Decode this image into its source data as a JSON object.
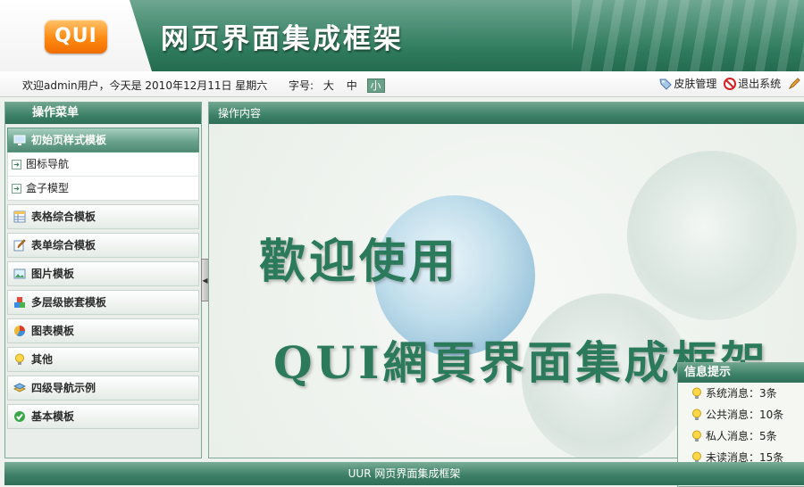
{
  "app": {
    "logo_text": "QUI",
    "title": "网页界面集成框架"
  },
  "statusbar": {
    "welcome": "欢迎admin用户，今天是 2010年12月11日 星期六",
    "font_label": "字号:",
    "font_sizes": [
      "大",
      "中",
      "小"
    ],
    "font_selected": "小",
    "skin_label": "皮肤管理",
    "logout_label": "退出系统"
  },
  "sidebar": {
    "title": "操作菜单",
    "active_item": "初始页样式模板",
    "sub_items": [
      "图标导航",
      "盒子模型"
    ],
    "groups": [
      {
        "label": "表格综合模板",
        "icon": "table-icon"
      },
      {
        "label": "表单综合模板",
        "icon": "form-edit-icon"
      },
      {
        "label": "图片模板",
        "icon": "image-icon"
      },
      {
        "label": "多层级嵌套模板",
        "icon": "nested-cubes-icon"
      },
      {
        "label": "图表模板",
        "icon": "pie-chart-icon"
      },
      {
        "label": "其他",
        "icon": "lightbulb-icon"
      },
      {
        "label": "四级导航示例",
        "icon": "layers-icon"
      },
      {
        "label": "基本模板",
        "icon": "check-icon"
      }
    ]
  },
  "main": {
    "title": "操作内容",
    "welcome_line1": "歡迎使用",
    "welcome_line2": "QUI網頁界面集成框架"
  },
  "info_panel": {
    "title": "信息提示",
    "items": [
      "系统消息：3条",
      "公共消息：10条",
      "私人消息：5条",
      "未读消息：15条"
    ]
  },
  "footer": {
    "text": "UUR 网页界面集成框架"
  },
  "colors": {
    "brand_green": "#2f7b5e",
    "logo_orange": "#ff8a12"
  }
}
